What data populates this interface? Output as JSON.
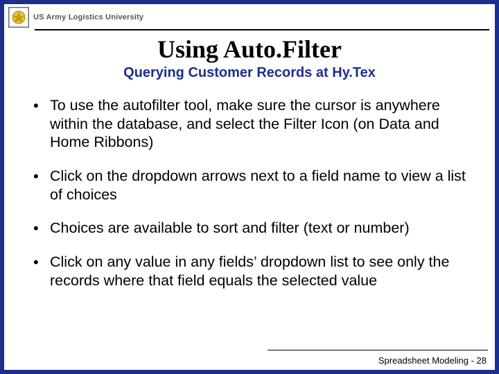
{
  "header": {
    "org_name": "US Army Logistics University"
  },
  "title": "Using Auto.Filter",
  "subtitle": "Querying Customer Records at Hy.Tex",
  "bullets": [
    "To use the autofilter tool, make sure the cursor is anywhere within the database, and select the Filter Icon (on Data and Home Ribbons)",
    "Click on the dropdown arrows next to a field name to view a list of choices",
    "Choices are available to sort and filter (text or number)",
    "Click on any value in any fields’ dropdown list to see only the records where that field equals the selected value"
  ],
  "footer": "Spreadsheet Modeling - 28"
}
